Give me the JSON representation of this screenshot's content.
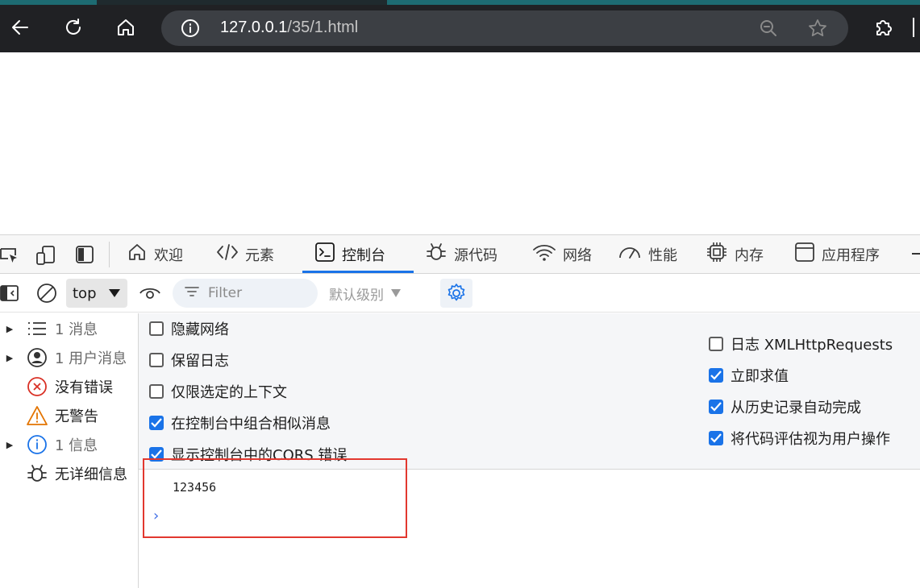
{
  "browser": {
    "url_host": "127.0.0.1",
    "url_path": "/35/1.html",
    "icons": [
      "back-icon",
      "reload-icon",
      "home-icon",
      "info-icon",
      "zoom-out-icon",
      "favorite-star-icon",
      "extensions-icon"
    ]
  },
  "devtools": {
    "tabs": [
      {
        "label": "欢迎",
        "icon": "home-icon"
      },
      {
        "label": "元素",
        "icon": "code-icon"
      },
      {
        "label": "控制台",
        "icon": "console-icon",
        "active": true
      },
      {
        "label": "源代码",
        "icon": "bug-icon"
      },
      {
        "label": "网络",
        "icon": "wifi-icon"
      },
      {
        "label": "性能",
        "icon": "gauge-icon"
      },
      {
        "label": "内存",
        "icon": "chip-icon"
      },
      {
        "label": "应用程序",
        "icon": "app-window-icon"
      }
    ],
    "toolbar": {
      "context": "top",
      "filter_placeholder": "Filter",
      "levels": "默认级别"
    },
    "sidebar": [
      {
        "label": "1 消息",
        "icon": "list-icon",
        "expandable": true,
        "muted": true
      },
      {
        "label": "1 用户消息",
        "icon": "user-icon",
        "expandable": true,
        "muted": true
      },
      {
        "label": "没有错误",
        "icon": "error-icon",
        "expandable": false,
        "muted": false
      },
      {
        "label": "无警告",
        "icon": "warning-icon",
        "expandable": false,
        "muted": false
      },
      {
        "label": "1 信息",
        "icon": "info-icon",
        "expandable": true,
        "muted": true
      },
      {
        "label": "无详细信息",
        "icon": "bug-icon",
        "expandable": false,
        "muted": false
      }
    ],
    "settings_left": [
      {
        "label": "隐藏网络",
        "checked": false
      },
      {
        "label": "保留日志",
        "checked": false
      },
      {
        "label": "仅限选定的上下文",
        "checked": false
      },
      {
        "label": "在控制台中组合相似消息",
        "checked": true
      },
      {
        "label": "显示控制台中的CORS 错误",
        "checked": true
      }
    ],
    "settings_right": [
      {
        "label": "日志 XMLHttpRequests",
        "checked": false
      },
      {
        "label": "立即求值",
        "checked": true
      },
      {
        "label": "从历史记录自动完成",
        "checked": true
      },
      {
        "label": "将代码评估视为用户操作",
        "checked": true
      }
    ],
    "console": {
      "output": "123456",
      "prompt": "›"
    },
    "colors": {
      "accent": "#1a73e8",
      "highlight": "#e2382f"
    }
  }
}
